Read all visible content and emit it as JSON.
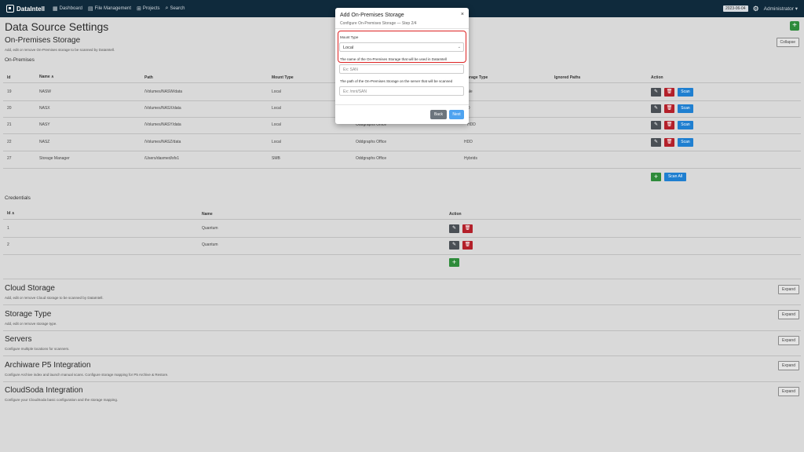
{
  "navbar": {
    "brand": "DataIntell",
    "items": [
      {
        "icon": "dashboard-icon",
        "glyph": "▦",
        "label": "Dashboard"
      },
      {
        "icon": "file-management-icon",
        "glyph": "▤",
        "label": "File Management"
      },
      {
        "icon": "projects-icon",
        "glyph": "⊞",
        "label": "Projects"
      },
      {
        "icon": "search-icon",
        "glyph": "⌕",
        "label": "Search"
      }
    ],
    "date": "2023-06-04",
    "user": "Administrator ▾"
  },
  "page": {
    "title": "Data Source Settings",
    "add_glyph": "+"
  },
  "onprem": {
    "title": "On-Premises Storage",
    "subtitle": "Add, edit or remove On-Premises storage to be scanned by DataIntell.",
    "collapse_label": "Collapse",
    "table_title": "On-Premises",
    "headers": [
      "Id",
      "Name ∧",
      "Path",
      "Mount Type",
      "",
      "orage Type",
      "Ignored Paths",
      "Action"
    ],
    "rows": [
      {
        "id": "19",
        "name": "NASW",
        "path": "/Volumes/NASW/data",
        "mount": "Local",
        "storage_partial": "",
        "storage_type": "ale"
      },
      {
        "id": "20",
        "name": "NASX",
        "path": "/Volumes/NASX/data",
        "mount": "Local",
        "storage_partial": "",
        "storage_type": "D"
      },
      {
        "id": "21",
        "name": "NASY",
        "path": "/Volumes/NASY/data",
        "mount": "Local",
        "storage_partial": "Oddgraphs Office",
        "storage_type": "HDD"
      },
      {
        "id": "22",
        "name": "NASZ",
        "path": "/Volumes/NASZ/data",
        "mount": "Local",
        "storage_partial": "Oddgraphs Office",
        "storage_type": "HDD"
      },
      {
        "id": "27",
        "name": "Storage Manager",
        "path": "/Users/dasmed/sfx1",
        "mount": "SMB",
        "storage_partial": "Oddgraphs Office",
        "storage_type": "Hybrids"
      }
    ],
    "scan_label": "Scan",
    "scan_all_label": "Scan All"
  },
  "credentials": {
    "title": "Credentials",
    "headers": [
      "Id ∧",
      "Name",
      "Action"
    ],
    "rows": [
      {
        "id": "1",
        "name": "Quantum"
      },
      {
        "id": "2",
        "name": "Quantum"
      }
    ]
  },
  "sections": [
    {
      "title": "Cloud Storage",
      "subtitle": "Add, edit or remove Cloud storage to be scanned by DataIntell.",
      "button": "Expand"
    },
    {
      "title": "Storage Type",
      "subtitle": "Add, edit or remove storage type.",
      "button": "Expand"
    },
    {
      "title": "Servers",
      "subtitle": "Configure multiple locations for scanners.",
      "button": "Expand"
    },
    {
      "title": "Archiware P5 Integration",
      "subtitle": "Configure Archive index and launch manual scans. Configure storage mapping for P5 Archive & Restore.",
      "button": "Expand"
    },
    {
      "title": "CloudSoda Integration",
      "subtitle": "Configure your CloudSoda basic configuration and the storage mapping.",
      "button": "Expand"
    }
  ],
  "modal": {
    "title": "Add On-Premises Storage",
    "subtitle": "Configure On-Premises Storage — Step 2/4",
    "close": "×",
    "mount_label": "Mount Type",
    "mount_value": "Local",
    "name_help": "The name of the On-Premises Storage that will be used in DataIntell",
    "name_placeholder": "Ex: SAN",
    "path_help": "The path of the On-Premises Storage on the server that will be scanned",
    "path_placeholder": "Ex: /mnt/SAN",
    "back_label": "Back",
    "next_label": "Next"
  },
  "icons": {
    "edit": "✎",
    "delete": "🗑",
    "add": "+",
    "gear": "⚙",
    "caret": "⌄"
  }
}
